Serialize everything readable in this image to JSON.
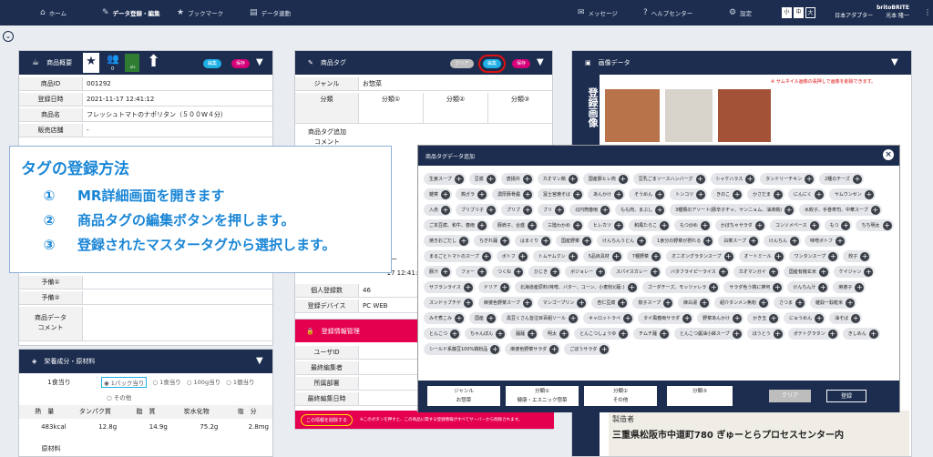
{
  "nav": {
    "home": "ホーム",
    "data_reg": "データ登録・編集",
    "bookmark": "ブックマーク",
    "data_links": "データ連動",
    "message": "メッセージ",
    "help": "ヘルプセンター",
    "settings": "設定",
    "size_small": "小",
    "size_mid": "中",
    "size_large": "大",
    "user_company": "britoBRITE",
    "user_org": "日本アダプター",
    "user_name": "光本 隆一"
  },
  "product": {
    "title": "商品概要",
    "edit": "編集",
    "save": "保存",
    "xls": ".xls",
    "count": "0",
    "rows": [
      {
        "label": "商品ID",
        "value": "001292"
      },
      {
        "label": "登録日時",
        "value": "2021-11-17 12:41:12"
      },
      {
        "label": "商品名",
        "value": "フレッシュトマトのナポリタン（５００W４分）"
      },
      {
        "label": "販売店舗",
        "value": "-"
      }
    ],
    "yobi1": "予備①",
    "yobi2": "予備②",
    "memo": "商品データ\nコメント"
  },
  "nutrition": {
    "title": "栄養成分・原材料",
    "serving_label": "1食当り",
    "options": [
      "1パック当り",
      "1食当り",
      "100g当り",
      "1個当り",
      "その他"
    ],
    "headers": [
      "熱　量",
      "タンパク質",
      "脂　質",
      "炭水化物",
      "塩　分"
    ],
    "values": [
      "483kcal",
      "12.8g",
      "14.9g",
      "75.2g",
      "2.8mg"
    ],
    "material": "原材料"
  },
  "tag": {
    "title": "商品タグ",
    "clear": "クリア",
    "edit": "編集",
    "save": "保存",
    "genre_label": "ジャンル",
    "genre_value": "お惣菜",
    "bunrui_label": "分類",
    "cols": [
      "分類①",
      "分類②",
      "分類③"
    ],
    "comment_label": "商品タグ追加\nコメント",
    "registrant_label": "個人登録数",
    "registrant_value": "46",
    "device_label": "登録デバイス",
    "device_value": "PC WEB",
    "date_partial": "-17 12:41:",
    "center_partial": "ター"
  },
  "reg": {
    "title": "登録情報管理",
    "rows": [
      "ユーザID",
      "最終編集者",
      "所属部署",
      "最終編集日時"
    ],
    "share_btn": "この情報を削除する",
    "share_note": "※このボタンを押すと、この商品に関する登録情報がすべてサーバーから削除されます。"
  },
  "image": {
    "title": "画像データ",
    "note": "※ サムネイル画像の長押しで画像を削除できます。",
    "vertical": "登録画像",
    "label_bottom": "三重県松阪市中道町780 ぎゅーとらプロセスセンター内",
    "label_top": "製造者"
  },
  "overlay": {
    "title": "タグの登録方法",
    "steps": [
      {
        "n": "①",
        "t": "MR詳細画面を開きます"
      },
      {
        "n": "②",
        "t": "商品タグの編集ボタンを押します。"
      },
      {
        "n": "③",
        "t": "登録されたマスタータグから選択します。"
      }
    ]
  },
  "modal": {
    "title": "商品タグデータ追加",
    "close": "×",
    "tags": [
      "生姜スープ",
      "豆腐",
      "唐揚弁",
      "カオマン鶏",
      "国産豚ヒレ肉",
      "豆乳ごまソースハンバーグ",
      "シャケハラス",
      "タンドリーチキン",
      "2種のチーズ",
      "雑菜",
      "鶏ガラ",
      "濃厚豚骨醤",
      "冨士宮焼そば",
      "あんかけ",
      "そうめん",
      "トンコツ",
      "きのこ",
      "かさだま",
      "にんにく",
      "ヤムウンセン",
      "入赤",
      "ブリブリ子",
      "プリブ",
      "ブリ",
      "北円筒春雨",
      "もも肉、まぶし",
      "3種類のアソート(豚辛子チャ、ヤンニョム、油淋鶏)",
      "水餃子、手巻寿司、中華スープ",
      "ご本豆腐、和牛、春雨",
      "豚肩子、合盛",
      "三陸わかめ",
      "ヒレカツ",
      "和風たらこ",
      "もつ炒め",
      "かぼちゃサラダ",
      "コンソメベース",
      "もつ",
      "ちち明太",
      "焼きおごだし",
      "ちぎれ麺",
      "はまぐり",
      "国産野菜",
      "けんちんうどん",
      "1食分の野菜が摂れる",
      "白菜スープ",
      "けんちん",
      "味噌ボトフ",
      "まるごとトマトのスープ",
      "ボトフ",
      "トムヤムクン",
      "5品目具材",
      "7種野菜",
      "オニオングラタンスープ",
      "オートミール",
      "ワンタンスープ",
      "餃子",
      "豚汁",
      "フォー",
      "つくね",
      "ひじき",
      "ボジョレー",
      "スパイスカレー",
      "バタフライピーライス",
      "カオマンガイ",
      "国産有機玄米",
      "ケイジャン",
      "サフランライス",
      "ドリア",
      "北海道産原料(味噌、バター、コーン、小麦粉)(麺：)",
      "ゴーダチーズ、モッツァレラ",
      "サラダ色う鶏に捧何",
      "けんちん汁",
      "麻婆子",
      "スンドゥブチゲ",
      "麻婆色野菜スープ",
      "マンゴープリン",
      "杏仁豆腐",
      "餃子スープ",
      "麻白湯",
      "紹介タンメン焦粉",
      "さつま",
      "雑穀一穀乾米",
      "みそ煮こみ",
      "国産",
      "黒豆くさん皆泣目百組ソール",
      "キャロットラペ",
      "タイ風春雨サラダ",
      "野菜あんかけ",
      "かき玉",
      "にゅうめん",
      "油そば",
      "とんこつ",
      "ちゃんぽん",
      "麺麺",
      "明太",
      "とんこつしょうゆ",
      "チムチ麺",
      "とんこつ醤油小鉢スープ",
      "ほうとう",
      "ポテトグラタン",
      "きしめん",
      "シールド系藤豆100%鶏粉品",
      "麻婆色野菜サラダ",
      "ごぼうサラダ"
    ],
    "foot_genre": "ジャンル",
    "foot_genre_val": "お惣菜",
    "foot_b1": "分類①",
    "foot_b1_val": "健康・エスニック惣菜",
    "foot_b2": "分類②",
    "foot_b2_val": "その他",
    "foot_b3": "分類③",
    "clear": "クリア",
    "register": "登録"
  },
  "colors": {
    "navy": "#1c2d4f",
    "blue": "#1a86d6",
    "pink": "#e5004f",
    "cyan": "#1fb0e6",
    "magenta": "#d6007a"
  }
}
